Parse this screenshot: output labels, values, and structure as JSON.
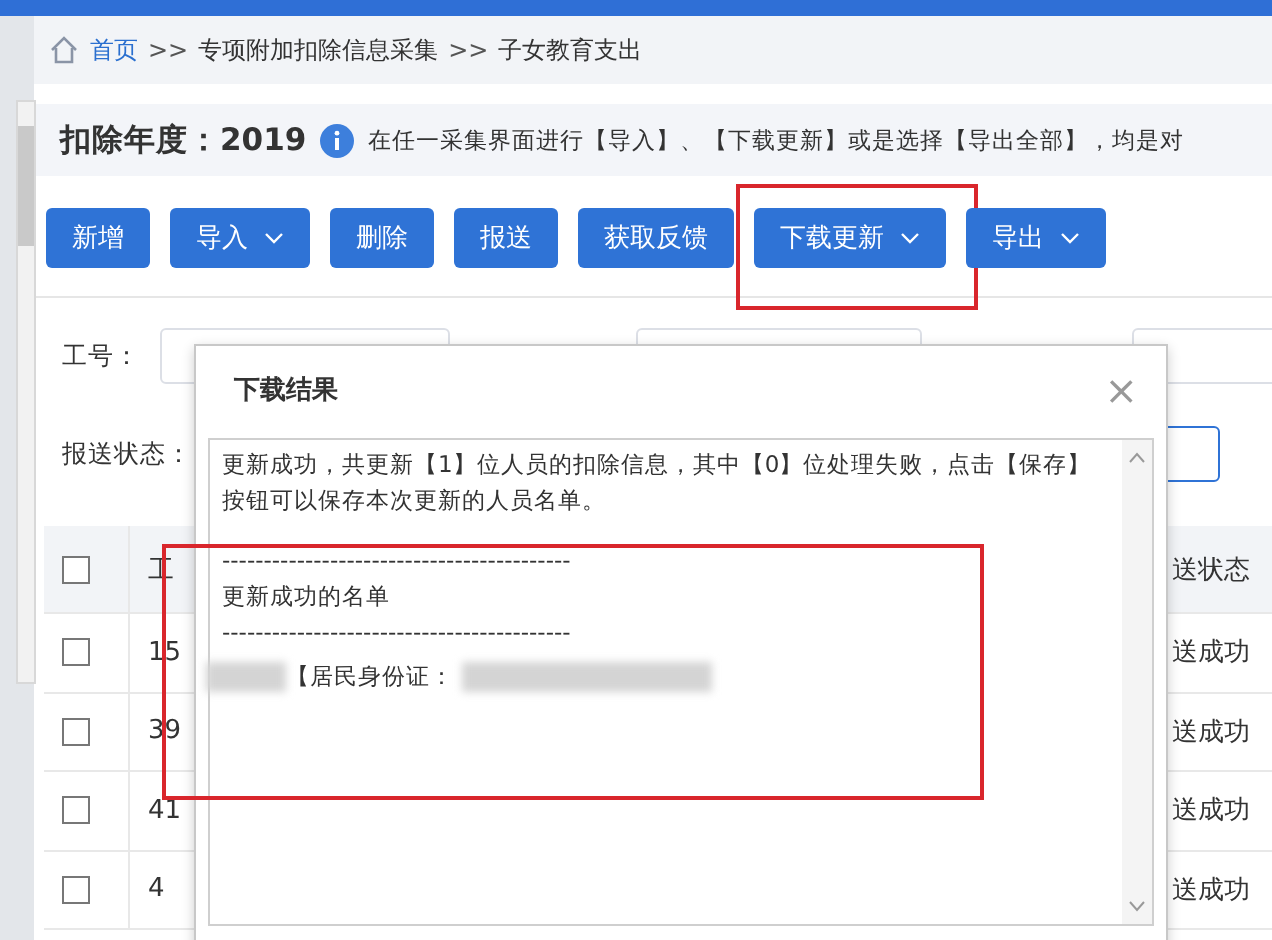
{
  "breadcrumb": [
    {
      "kind": "link",
      "label": "首页"
    },
    {
      "kind": "separator",
      "label": ">>"
    },
    {
      "kind": "text",
      "label": "专项附加扣除信息采集"
    },
    {
      "kind": "separator",
      "label": ">>"
    },
    {
      "kind": "text",
      "label": "子女教育支出"
    }
  ],
  "year_bar": {
    "label": "扣除年度：2019",
    "notice": "在任一采集界面进行【导入】、【下载更新】或是选择【导出全部】，均是对"
  },
  "toolbar": [
    {
      "label": "新增",
      "dropdown": false,
      "highlighted": false
    },
    {
      "label": "导入",
      "dropdown": true,
      "highlighted": false
    },
    {
      "label": "删除",
      "dropdown": false,
      "highlighted": false
    },
    {
      "label": "报送",
      "dropdown": false,
      "highlighted": false
    },
    {
      "label": "获取反馈",
      "dropdown": false,
      "highlighted": false
    },
    {
      "label": "下载更新",
      "dropdown": true,
      "highlighted": true
    },
    {
      "label": "导出",
      "dropdown": true,
      "highlighted": false
    }
  ],
  "filters": [
    {
      "label": "工号："
    },
    {
      "label": "报送状态："
    }
  ],
  "table": {
    "header_checked": false,
    "columns": [
      "工",
      "送状态"
    ],
    "rows": [
      {
        "checked": false,
        "column_1": "15",
        "column_2": "送成功"
      },
      {
        "checked": false,
        "column_1": "39",
        "column_2": "送成功"
      },
      {
        "checked": false,
        "column_1": "41",
        "column_2": "送成功"
      },
      {
        "checked": false,
        "column_1": "4",
        "column_2": "送成功"
      }
    ]
  },
  "dialog": {
    "title": "下载结果",
    "close": "×",
    "message": "更新成功，共更新【1】位人员的扣除信息，其中【0】位处理失败，点击【保存】按钮可以保存本次更新的人员名单。",
    "divider_1": "------------------------------------------",
    "list_title": "更新成功的名单",
    "divider_2": "------------------------------------------",
    "entry_label": "【居民身份证：",
    "list_highlighted": true
  }
}
